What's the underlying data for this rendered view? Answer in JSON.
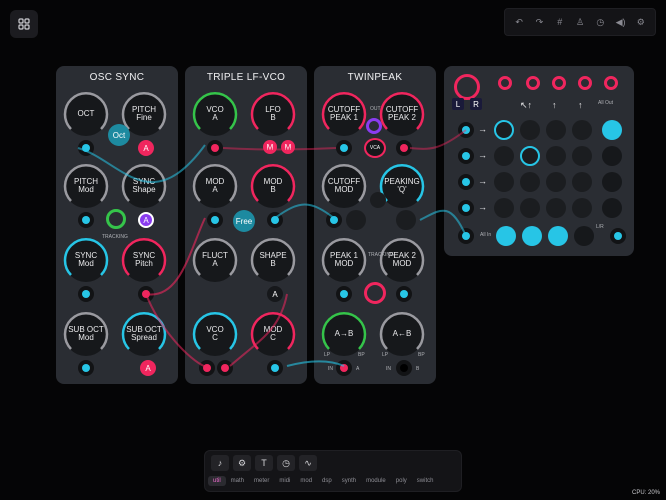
{
  "window": {
    "cpu": "CPU: 20%"
  },
  "toolbar": {
    "icons": [
      "undo-icon",
      "redo-icon",
      "grid-icon",
      "tuner-icon",
      "clock-icon",
      "speaker-icon",
      "settings-icon"
    ]
  },
  "panels": {
    "osc_sync": {
      "title": "OSC SYNC",
      "oct": "OCT",
      "pitch_fine": [
        "PITCH",
        "Fine"
      ],
      "oct_btn": "Oct",
      "a_btn": "A",
      "pitch_mod": [
        "PITCH",
        "Mod"
      ],
      "sync_shape": [
        "SYNC",
        "Shape"
      ],
      "tracking": "TRACKING",
      "a2": "A",
      "sync_mod": [
        "SYNC",
        "Mod"
      ],
      "sync_pitch": [
        "SYNC",
        "Pitch"
      ],
      "sub_oct_mod": [
        "SUB OCT",
        "Mod"
      ],
      "sub_oct_spread": [
        "SUB OCT",
        "Spread"
      ],
      "a3": "A"
    },
    "lfvco": {
      "title": "TRIPLE LF-VCO",
      "vco_a": [
        "VCO",
        "A"
      ],
      "lfo_b": [
        "LFO",
        "B"
      ],
      "m1": "M",
      "m2": "M",
      "mod_a": [
        "MOD",
        "A"
      ],
      "mod_b": [
        "MOD",
        "B"
      ],
      "free": "Free",
      "fluct_a": [
        "FLUCT",
        "A"
      ],
      "shape_b": [
        "SHAPE",
        "B"
      ],
      "a": "A",
      "vco_c": [
        "VCO",
        "C"
      ],
      "mod_c": [
        "MOD",
        "C"
      ]
    },
    "twinpeak": {
      "title": "TWINPEAK",
      "cutoff1": [
        "CUTOFF",
        "PEAK 1"
      ],
      "cutoff2": [
        "CUTOFF",
        "PEAK 2"
      ],
      "out": "OUT",
      "vca": "VCA",
      "cutoff_mod": [
        "CUTOFF",
        "MOD"
      ],
      "peaking": [
        "PEAKING",
        "'Q'"
      ],
      "peak1_mod": [
        "PEAK 1",
        "MOD"
      ],
      "peak2_mod": [
        "PEAK 2",
        "MOD"
      ],
      "ab": "A→B",
      "ba": "A←B",
      "lp": "LP",
      "bp": "BP",
      "lp2": "LP",
      "bp2": "BP",
      "in": "IN",
      "a": "A",
      "in2": "IN",
      "b": "B",
      "tracking": "TRACKING"
    },
    "mixer": {
      "all_out": "All Out",
      "all_in": "All In",
      "l": "L",
      "r": "R",
      "lr": "L/R"
    }
  },
  "bottombar": {
    "tabs": [
      "util",
      "math",
      "meter",
      "midi",
      "mod",
      "dsp",
      "synth",
      "module",
      "poly",
      "switch"
    ],
    "active_tab": "util",
    "icons": [
      "mic-icon",
      "gear-icon",
      "text-icon",
      "clock-icon",
      "wave-icon"
    ]
  },
  "colors": {
    "cyan": "#27c5e6",
    "pink": "#f0265e",
    "purple": "#8a3cf0",
    "green": "#35c44a"
  }
}
